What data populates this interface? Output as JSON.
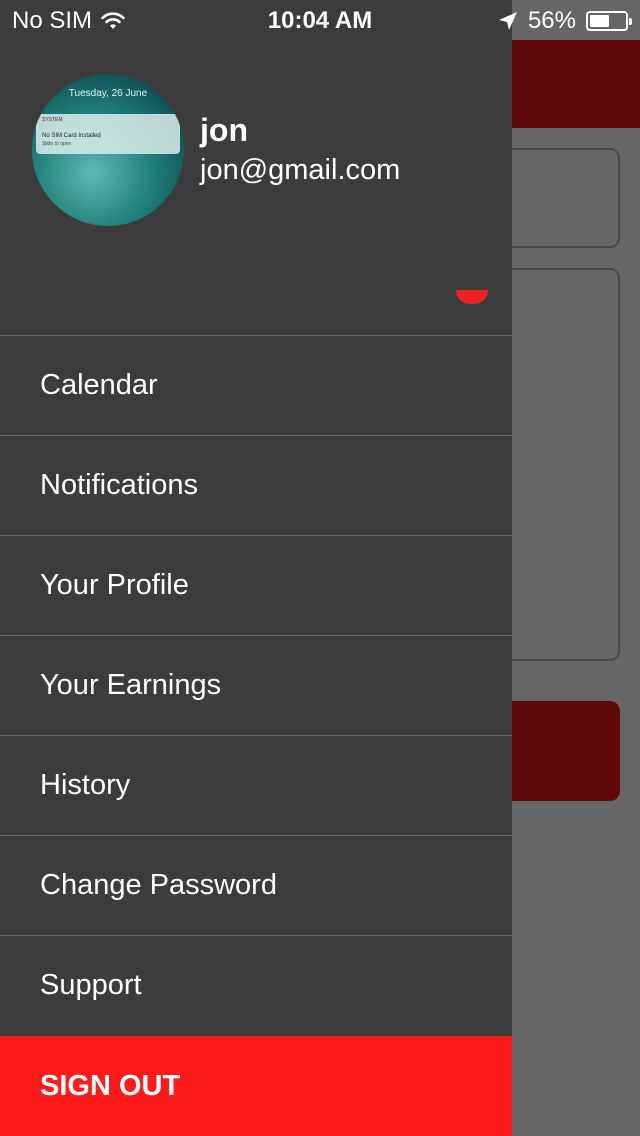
{
  "status_bar": {
    "carrier": "No SIM",
    "time": "10:04 AM",
    "battery_percent_text": "56%",
    "battery_level": 0.56
  },
  "profile": {
    "name": "jon",
    "email": "jon@gmail.com",
    "avatar": {
      "date_text": "Tuesday, 26 June",
      "notif_app": "SYSTEM",
      "notif_title": "No SIM Card Installed",
      "notif_sub": "Slide to open"
    }
  },
  "menu": {
    "items": [
      {
        "label": "Calendar"
      },
      {
        "label": "Notifications"
      },
      {
        "label": "Your Profile"
      },
      {
        "label": "Your Earnings"
      },
      {
        "label": "History"
      },
      {
        "label": "Change Password"
      },
      {
        "label": "Support"
      }
    ],
    "signout_label": "SIGN OUT"
  },
  "colors": {
    "drawer_bg": "#3c3c3c",
    "accent_red": "#ff1a1a",
    "header_dark_red": "#610a0a",
    "backdrop": "#666666"
  }
}
